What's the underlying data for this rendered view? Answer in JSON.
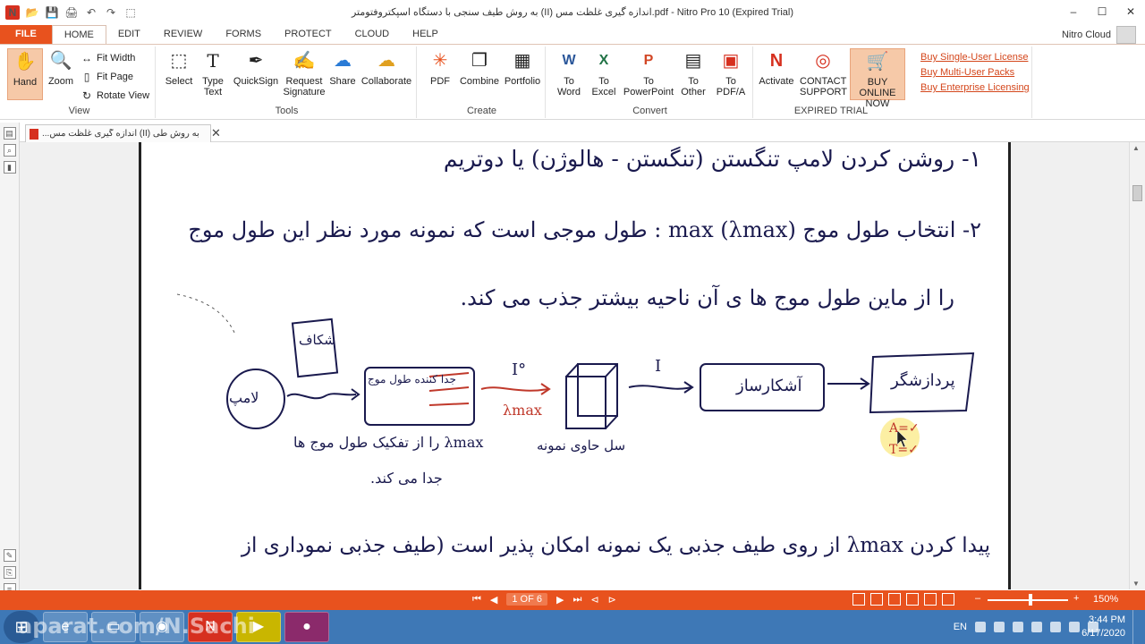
{
  "window": {
    "title": "به روش طیف سنجی با دستگاه اسپکتروفتومتر (II) اندازه گیری غلظت مس.pdf - Nitro Pro 10 (Expired Trial)",
    "controls": [
      "–",
      "☐",
      "✕"
    ],
    "qat": [
      "📂",
      "💾",
      "🖨",
      "↶",
      "↷",
      "⬚"
    ]
  },
  "tabs": {
    "file": "FILE",
    "items": [
      "HOME",
      "EDIT",
      "REVIEW",
      "FORMS",
      "PROTECT",
      "CLOUD",
      "HELP"
    ],
    "active": "HOME",
    "account": "Nitro Cloud"
  },
  "ribbon": {
    "view": {
      "label": "View",
      "hand": "Hand",
      "zoom": "Zoom",
      "fit_width": "Fit Width",
      "fit_page": "Fit Page",
      "rotate_view": "Rotate View"
    },
    "tools": {
      "label": "Tools",
      "select": "Select",
      "type_text_1": "Type",
      "type_text_2": "Text",
      "quicksign": "QuickSign",
      "request_sig_1": "Request",
      "request_sig_2": "Signature",
      "share": "Share",
      "collaborate": "Collaborate"
    },
    "create": {
      "label": "Create",
      "pdf": "PDF",
      "combine": "Combine",
      "portfolio": "Portfolio"
    },
    "convert": {
      "label": "Convert",
      "to_word_1": "To",
      "to_word_2": "Word",
      "to_excel_1": "To",
      "to_excel_2": "Excel",
      "to_ppt_1": "To",
      "to_ppt_2": "PowerPoint",
      "to_other_1": "To",
      "to_other_2": "Other",
      "to_pdfa_1": "To",
      "to_pdfa_2": "PDF/A"
    },
    "expired": {
      "label": "EXPIRED TRIAL",
      "activate": "Activate",
      "contact_1": "CONTACT",
      "contact_2": "SUPPORT",
      "buy_1": "BUY ONLINE",
      "buy_2": "NOW",
      "links": [
        "Buy Single-User License",
        "Buy Multi-User Packs",
        "Buy Enterprise Licensing"
      ]
    }
  },
  "doc_tab": {
    "label": "به روش طی (II) اندازه گیری غلظت مس...",
    "close": "✕"
  },
  "document": {
    "line1": "۱- روشن کردن لامپ تنگستن (تنگستن - هالوژن) یا دوتریم",
    "line2": "۲- انتخاب طول موج (λmax) max : طول موجی است که نمونه مورد نظر این طول موج",
    "line3": "را از ماین طول موج ها ی آن ناحیه بیشتر جذب می کند.",
    "lamp": "لامپ",
    "slit": "شکاف",
    "monochromator": "جدا کننده طول موج",
    "i0": "I°",
    "lambda_max": "λmax",
    "sample_cell": "سل حاوی نمونه",
    "i": "I",
    "detector": "آشکارساز",
    "processor": "پردازشگر",
    "note_1": "λmax را از تفکیک طول موج ها",
    "note_2": "جدا می کند.",
    "ann_a": "A=✓",
    "ann_t": "T=✓",
    "line_bottom": "پیدا کردن λmax از روی طیف جذبی یک نمونه امکان پذیر است (طیف جذبی نموداری از"
  },
  "statusbar": {
    "page_info": "1 OF 6",
    "zoom": "150%",
    "zoom_minus": "–",
    "zoom_plus": "+"
  },
  "taskbar": {
    "watermark": "aparat.com/N.Sachi",
    "lang": "EN",
    "time": "3:44 PM",
    "date": "6/17/2020"
  },
  "colors": {
    "accent": "#e8521e",
    "ink": "#1a1a4e",
    "red_ink": "#c0392b",
    "taskbar": "#3e78b6"
  }
}
